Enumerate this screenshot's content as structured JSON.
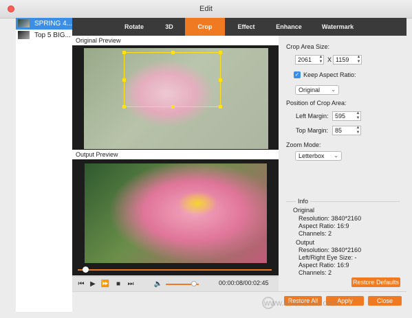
{
  "window": {
    "title": "Edit",
    "accent": "#f07a21"
  },
  "sidebar": {
    "items": [
      {
        "label": "SPRING 4...",
        "selected": true
      },
      {
        "label": "Top 5 BIG...",
        "selected": false
      }
    ]
  },
  "tabs": [
    "Rotate",
    "3D",
    "Crop",
    "Effect",
    "Enhance",
    "Watermark"
  ],
  "active_tab": "Crop",
  "preview": {
    "original_label": "Original Preview",
    "output_label": "Output Preview"
  },
  "player": {
    "time": "00:00:08/00:02:45",
    "icons": {
      "prev": "⏮",
      "play": "▶",
      "forward": "⏩",
      "stop": "■",
      "next": "⏭",
      "volume": "🔈"
    },
    "progress": 0.04,
    "volume": 0.85
  },
  "crop": {
    "area_label": "Crop Area Size:",
    "width": "2061",
    "x_sep": "X",
    "height": "1159",
    "keep_aspect_label": "Keep Aspect Ratio:",
    "keep_aspect_checked": true,
    "aspect_value": "Original",
    "position_label": "Position of Crop Area:",
    "left_margin_label": "Left Margin:",
    "left_margin": "595",
    "top_margin_label": "Top Margin:",
    "top_margin": "85",
    "zoom_label": "Zoom Mode:",
    "zoom_value": "Letterbox"
  },
  "info": {
    "title": "Info",
    "original_title": "Original",
    "orig_resolution": "Resolution: 3840*2160",
    "orig_aspect": "Aspect Ratio: 16:9",
    "orig_channels": "Channels: 2",
    "output_title": "Output",
    "out_resolution": "Resolution: 3840*2160",
    "out_eye": "Left/Right Eye Size: -",
    "out_aspect": "Aspect Ratio: 16:9",
    "out_channels": "Channels: 2"
  },
  "buttons": {
    "restore_defaults": "Restore Defaults",
    "restore_all": "Restore All",
    "apply": "Apply",
    "close": "Close"
  },
  "watermark_text": "www.MacDown.com"
}
